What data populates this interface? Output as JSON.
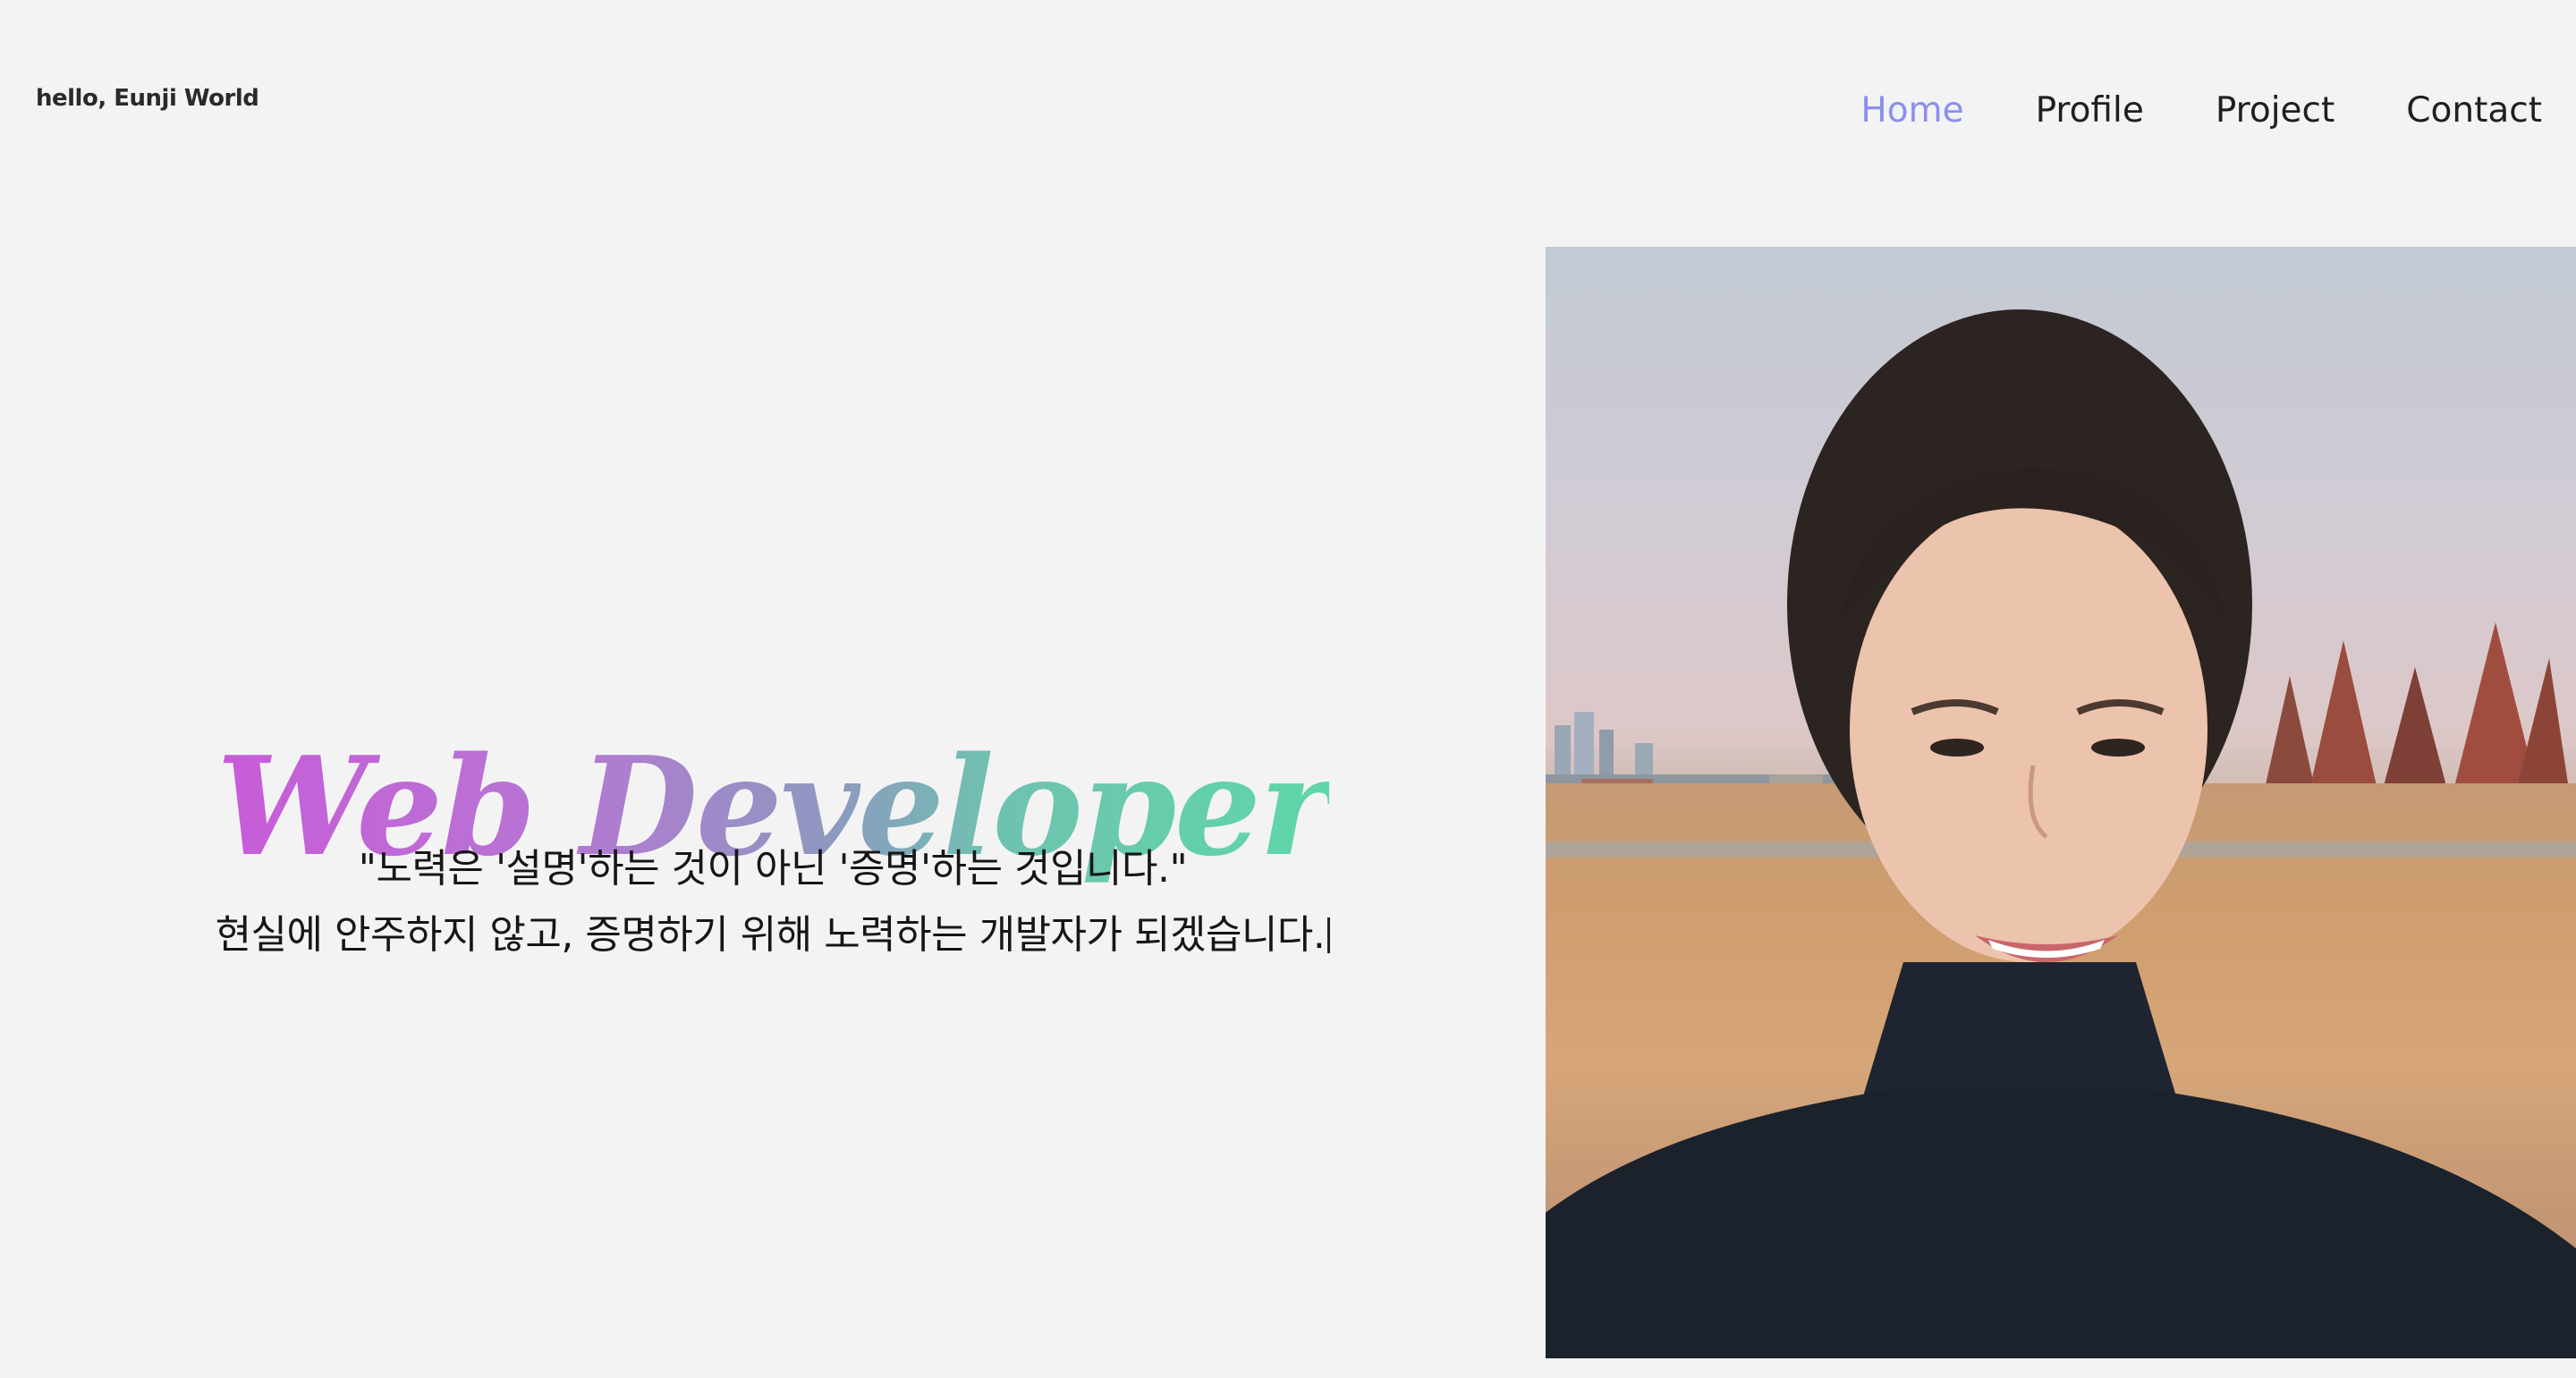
{
  "header": {
    "logo": "hello, Eunji World",
    "nav": [
      {
        "label": "Home",
        "active": true
      },
      {
        "label": "Profile",
        "active": false
      },
      {
        "label": "Project",
        "active": false
      },
      {
        "label": "Contact",
        "active": false
      }
    ]
  },
  "hero": {
    "title": "Web Developer",
    "quote_line1": "\"노력은 '설명'하는 것이 아닌 '증명'하는 것입니다.\"",
    "quote_line2": "현실에 안주하지 않고, 증명하기 위해 노력하는 개발자가 되겠습니다."
  },
  "colors": {
    "background": "#f3f3f3",
    "nav_active": "#8b8ff0",
    "gradient_start": "#c85bd8",
    "gradient_end": "#5ed7a8"
  }
}
